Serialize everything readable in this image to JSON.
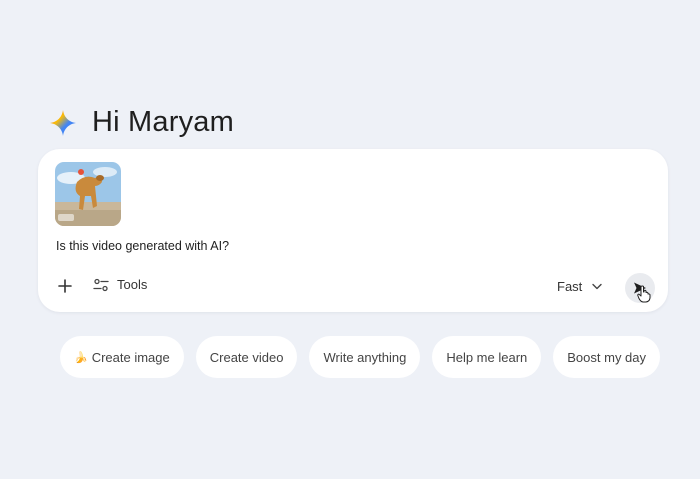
{
  "greeting": {
    "text": "Hi Maryam",
    "icon": "gemini-sparkle-icon"
  },
  "prompt": {
    "text": "Is this video generated with AI?",
    "attachment": {
      "type": "video-thumbnail",
      "description_icon": "dog-video-thumbnail"
    }
  },
  "toolbar": {
    "add_icon": "plus-icon",
    "tools_label": "Tools",
    "tools_icon": "sliders-icon",
    "model_label": "Fast",
    "model_icon": "chevron-down-icon",
    "send_icon": "send-icon"
  },
  "chips": [
    {
      "label": "Create image",
      "icon": "banana-icon"
    },
    {
      "label": "Create video"
    },
    {
      "label": "Write anything"
    },
    {
      "label": "Help me learn"
    },
    {
      "label": "Boost my day"
    }
  ],
  "colors": {
    "background": "#eef1f7",
    "card": "#ffffff",
    "sparkle_blue": "#4285f4",
    "sparkle_red": "#ea4335",
    "sparkle_yellow": "#fbbc04"
  }
}
